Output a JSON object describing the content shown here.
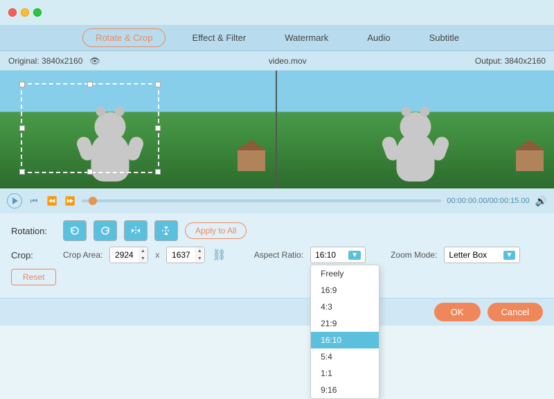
{
  "titlebar": {
    "traffic": [
      "close",
      "minimize",
      "maximize"
    ]
  },
  "tabs": {
    "items": [
      {
        "label": "Rotate & Crop",
        "active": true
      },
      {
        "label": "Effect & Filter",
        "active": false
      },
      {
        "label": "Watermark",
        "active": false
      },
      {
        "label": "Audio",
        "active": false
      },
      {
        "label": "Subtitle",
        "active": false
      }
    ]
  },
  "infobar": {
    "original": "Original: 3840x2160",
    "filename": "video.mov",
    "output": "Output: 3840x2160"
  },
  "playback": {
    "time_current": "00:00:00.00",
    "time_total": "00:00:15.00",
    "time_display": "00:00:00.00/00:00:15.00"
  },
  "controls": {
    "rotation_label": "Rotation:",
    "rotate_btns": [
      "↩",
      "↪",
      "↕",
      "↔"
    ],
    "apply_all": "Apply to All",
    "crop_label": "Crop:",
    "crop_area_label": "Crop Area:",
    "crop_w": "2924",
    "crop_h": "1637",
    "aspect_label": "Aspect Ratio:",
    "aspect_current": "16:10",
    "aspect_options": [
      {
        "label": "Freely",
        "selected": false
      },
      {
        "label": "16:9",
        "selected": false
      },
      {
        "label": "4:3",
        "selected": false
      },
      {
        "label": "21:9",
        "selected": false
      },
      {
        "label": "16:10",
        "selected": true
      },
      {
        "label": "5:4",
        "selected": false
      },
      {
        "label": "1:1",
        "selected": false
      },
      {
        "label": "9:16",
        "selected": false
      }
    ],
    "zoom_label": "Zoom Mode:",
    "zoom_current": "Letter Box",
    "reset_btn": "Reset"
  },
  "footer": {
    "ok": "OK",
    "cancel": "Cancel"
  }
}
